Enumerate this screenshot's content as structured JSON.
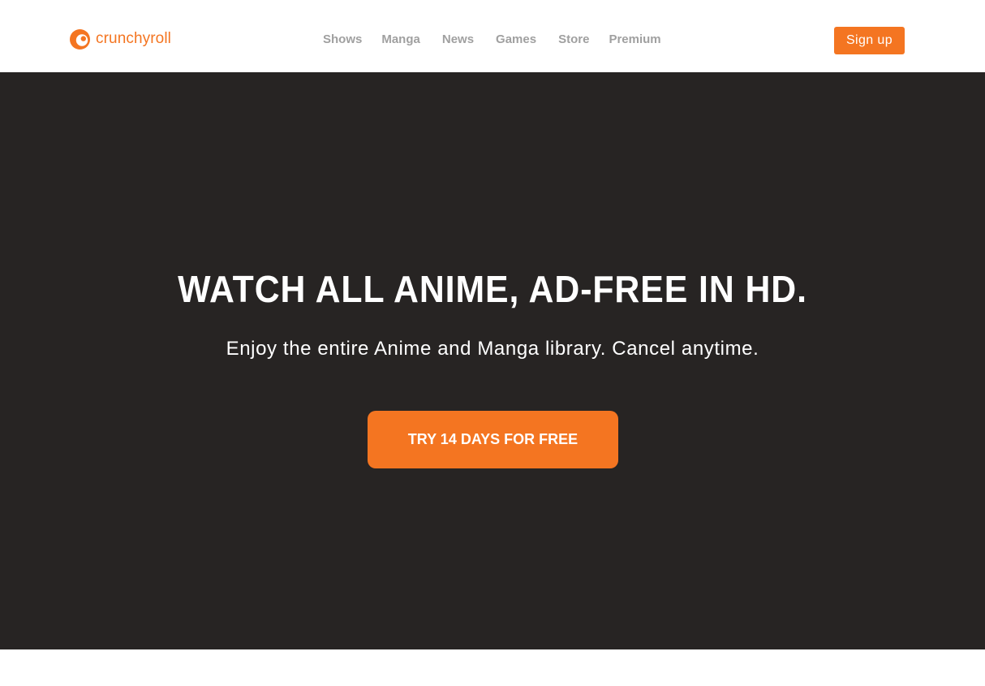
{
  "brand": {
    "name": "crunchyroll",
    "color": "#f47521",
    "icon": "crunchyroll-logo-icon"
  },
  "nav": {
    "items": [
      {
        "label": "Shows"
      },
      {
        "label": "Manga"
      },
      {
        "label": "News"
      },
      {
        "label": "Games"
      },
      {
        "label": "Store"
      },
      {
        "label": "Premium"
      }
    ]
  },
  "header": {
    "signup_label": "Sign up"
  },
  "hero": {
    "title": "WATCH ALL ANIME, AD-FREE IN HD.",
    "subtitle": "Enjoy the entire Anime and Manga library. Cancel anytime.",
    "cta_label": "TRY 14 DAYS FOR FREE",
    "background": "#272423"
  }
}
